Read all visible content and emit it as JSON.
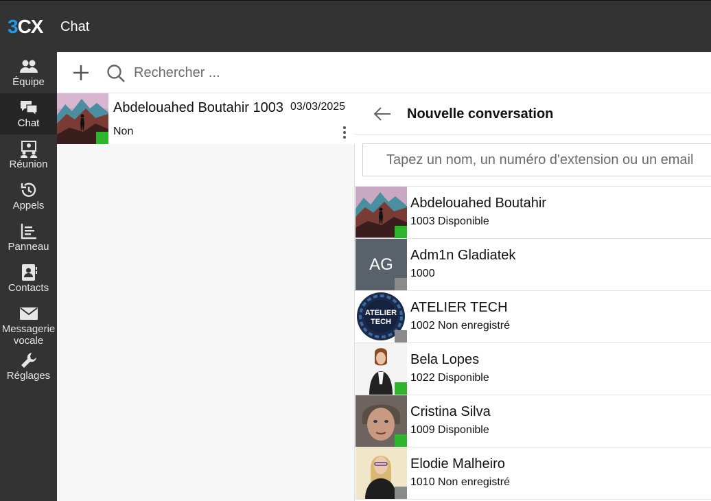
{
  "app": {
    "logo_3": "3",
    "logo_cx": "CX",
    "title": "Chat"
  },
  "sidebar": {
    "items": [
      {
        "label": "Équipe",
        "icon": "team-icon"
      },
      {
        "label": "Chat",
        "icon": "chat-icon",
        "active": true
      },
      {
        "label": "Réunion",
        "icon": "meeting-icon"
      },
      {
        "label": "Appels",
        "icon": "history-icon"
      },
      {
        "label": "Panneau",
        "icon": "panel-icon"
      },
      {
        "label": "Contacts",
        "icon": "contacts-icon"
      },
      {
        "label": "Messagerie vocale",
        "icon": "mail-icon"
      },
      {
        "label": "Réglages",
        "icon": "wrench-icon"
      }
    ]
  },
  "toolbar": {
    "search_placeholder": "Rechercher ..."
  },
  "conversations": [
    {
      "name": "Abdelouahed Boutahir 1003",
      "date": "03/03/2025",
      "last_message": "Non",
      "status_color": "#2db52d"
    }
  ],
  "new_conversation": {
    "title": "Nouvelle conversation",
    "input_placeholder": "Tapez un nom, un numéro d'extension ou un email",
    "contacts": [
      {
        "name": "Abdelouahed Boutahir",
        "sub": "1003 Disponible",
        "status": "available"
      },
      {
        "name": "Adm1n Gladiatek",
        "sub": "1000",
        "initials": "AG",
        "status": "offline"
      },
      {
        "name": "ATELIER TECH",
        "sub": "1002 Non enregistré",
        "logo_text": "ATELIER TECH",
        "status": "offline"
      },
      {
        "name": "Bela Lopes",
        "sub": "1022 Disponible",
        "status": "available"
      },
      {
        "name": "Cristina Silva",
        "sub": "1009 Disponible",
        "status": "available"
      },
      {
        "name": "Elodie Malheiro",
        "sub": "1010 Non enregistré",
        "status": "offline"
      }
    ]
  },
  "colors": {
    "available": "#2db52d",
    "offline": "#8a8a8a",
    "brand_blue": "#1e9be9",
    "dark_bg": "#333333"
  }
}
